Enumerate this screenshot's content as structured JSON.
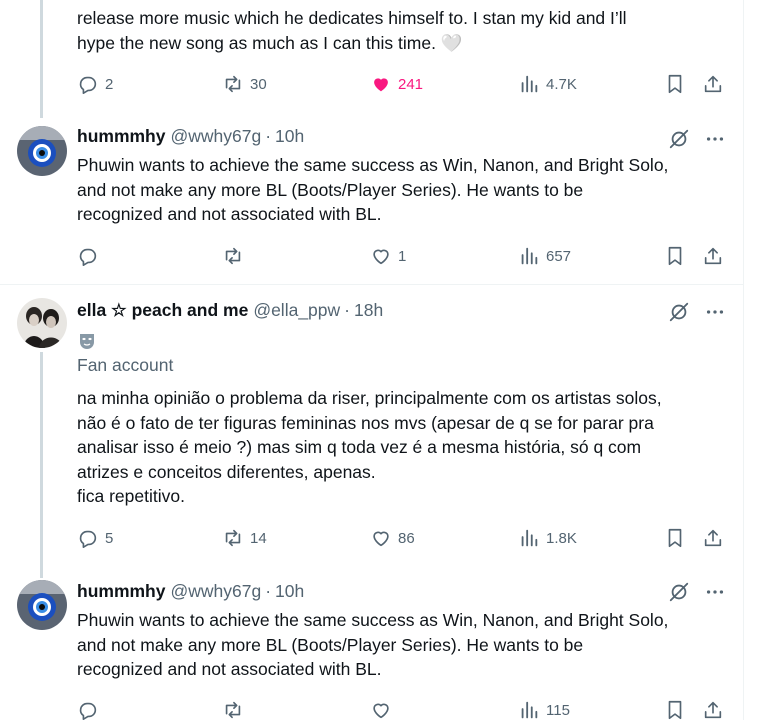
{
  "post0": {
    "text": "release more music which he dedicates himself to. I stan my kid and I’ll\nhype the new song as much as I can this time. 🤍",
    "replies": "2",
    "reposts": "30",
    "likes": "241",
    "views": "4.7K"
  },
  "post1": {
    "name": "hummmhy",
    "handle": "@wwhy67g",
    "dot": "·",
    "time": "10h",
    "text": "Phuwin wants to achieve the same success as Win, Nanon, and Bright Solo,\nand not make any more BL (Boots/Player Series). He wants to be\nrecognized and not associated with BL.",
    "replies": "",
    "reposts": "",
    "likes": "1",
    "views": "657"
  },
  "post2": {
    "name": "ella ☆ peach and me",
    "handle": "@ella_ppw",
    "dot": "·",
    "time": "18h",
    "badge_label": "Fan account",
    "text": "na minha opinião o problema da riser, principalmente com os artistas solos,\nnão é o fato de ter figuras femininas nos mvs (apesar de q se for parar pra\nanalisar isso é meio ?) mas sim q toda vez é a mesma história, só q com\natrizes e conceitos diferentes, apenas.\nfica repetitivo.",
    "replies": "5",
    "reposts": "14",
    "likes": "86",
    "views": "1.8K"
  },
  "post3": {
    "name": "hummmhy",
    "handle": "@wwhy67g",
    "dot": "·",
    "time": "10h",
    "text": "Phuwin wants to achieve the same success as Win, Nanon, and Bright Solo,\nand not make any more BL (Boots/Player Series). He wants to be\nrecognized and not associated with BL.",
    "replies": "",
    "reposts": "",
    "likes": "",
    "views": "115"
  },
  "icons": {
    "reply": "reply-icon",
    "repost": "repost-icon",
    "like": "heart-icon",
    "views": "views-icon",
    "bookmark": "bookmark-icon",
    "share": "share-icon",
    "grok": "grok-icon",
    "more": "more-icon"
  },
  "colors": {
    "like_active": "#f91880",
    "secondary": "#536471",
    "thread_line": "#cfd9de"
  }
}
